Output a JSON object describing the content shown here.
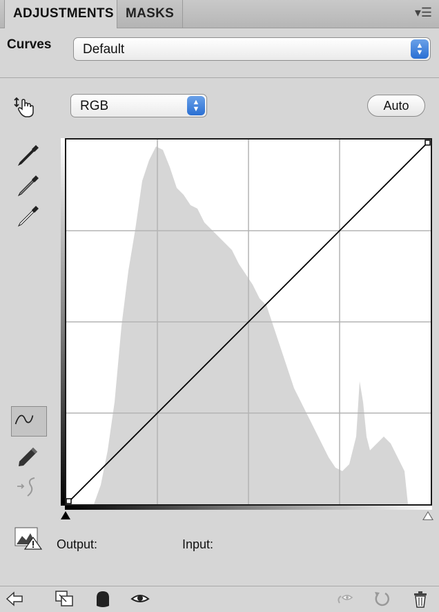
{
  "tabs": [
    {
      "label": "ADJUSTMENTS",
      "active": true
    },
    {
      "label": "MASKS",
      "active": false
    }
  ],
  "panel_menu_icon": "panel-menu-icon",
  "header": {
    "label": "Curves",
    "preset_value": "Default"
  },
  "channel": {
    "value": "RGB"
  },
  "auto_label": "Auto",
  "tools": [
    {
      "name": "eyedropper-black-icon"
    },
    {
      "name": "eyedropper-gray-icon"
    },
    {
      "name": "eyedropper-white-icon"
    },
    {
      "name": "curve-edit-icon"
    },
    {
      "name": "pencil-icon"
    },
    {
      "name": "smooth-curve-icon"
    }
  ],
  "graph": {
    "curve_points": [
      [
        0,
        0
      ],
      [
        255,
        255
      ]
    ],
    "grid_divisions": 4,
    "histogram_color": "#d6d6d6"
  },
  "io": {
    "output_label": "Output:",
    "input_label": "Input:"
  },
  "bottom_icons": [
    "back-arrow-icon",
    "clip-to-layer-icon",
    "layer-visibility-mask-icon",
    "view-previous-state-icon",
    "reset-icon",
    "delete-icon"
  ]
}
